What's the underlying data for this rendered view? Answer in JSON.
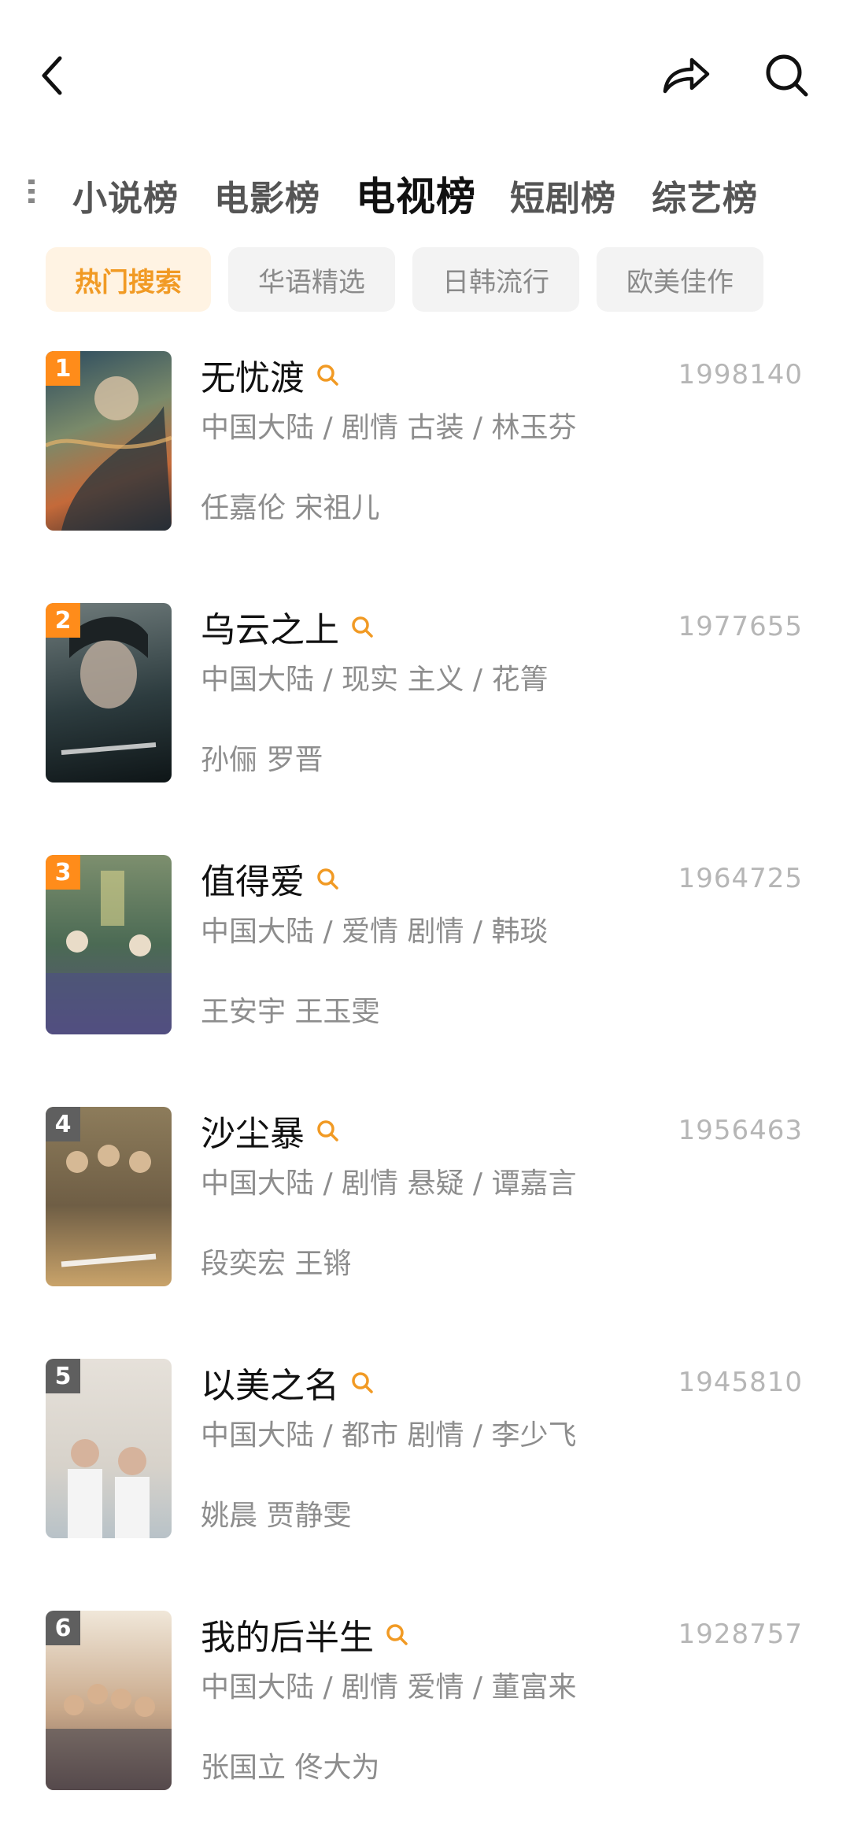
{
  "tabs": [
    "小说榜",
    "电影榜",
    "电视榜",
    "短剧榜",
    "综艺榜"
  ],
  "active_tab": "电视榜",
  "chips": [
    "热门搜索",
    "华语精选",
    "日韩流行",
    "欧美佳作"
  ],
  "active_chip": "热门搜索",
  "colors": {
    "accent": "#f19a24",
    "rank_top": "#ff8c1a",
    "rank_other": "#5f5f5f"
  },
  "items": [
    {
      "rank": "1",
      "title": "无忧渡",
      "score": "1998140",
      "meta": "中国大陆 / 剧情 古装 / 林玉芬",
      "cast": "任嘉伦 宋祖儿"
    },
    {
      "rank": "2",
      "title": "乌云之上",
      "score": "1977655",
      "meta": "中国大陆 / 现实 主义 / 花箐",
      "cast": "孙俪 罗晋"
    },
    {
      "rank": "3",
      "title": "值得爱",
      "score": "1964725",
      "meta": "中国大陆 / 爱情 剧情 / 韩琰",
      "cast": "王安宇 王玉雯"
    },
    {
      "rank": "4",
      "title": "沙尘暴",
      "score": "1956463",
      "meta": "中国大陆 / 剧情 悬疑 / 谭嘉言",
      "cast": "段奕宏 王锵"
    },
    {
      "rank": "5",
      "title": "以美之名",
      "score": "1945810",
      "meta": "中国大陆 / 都市 剧情 / 李少飞",
      "cast": "姚晨 贾静雯"
    },
    {
      "rank": "6",
      "title": "我的后半生",
      "score": "1928757",
      "meta": "中国大陆 / 剧情 爱情 / 董富来",
      "cast": "张国立 佟大为"
    }
  ]
}
